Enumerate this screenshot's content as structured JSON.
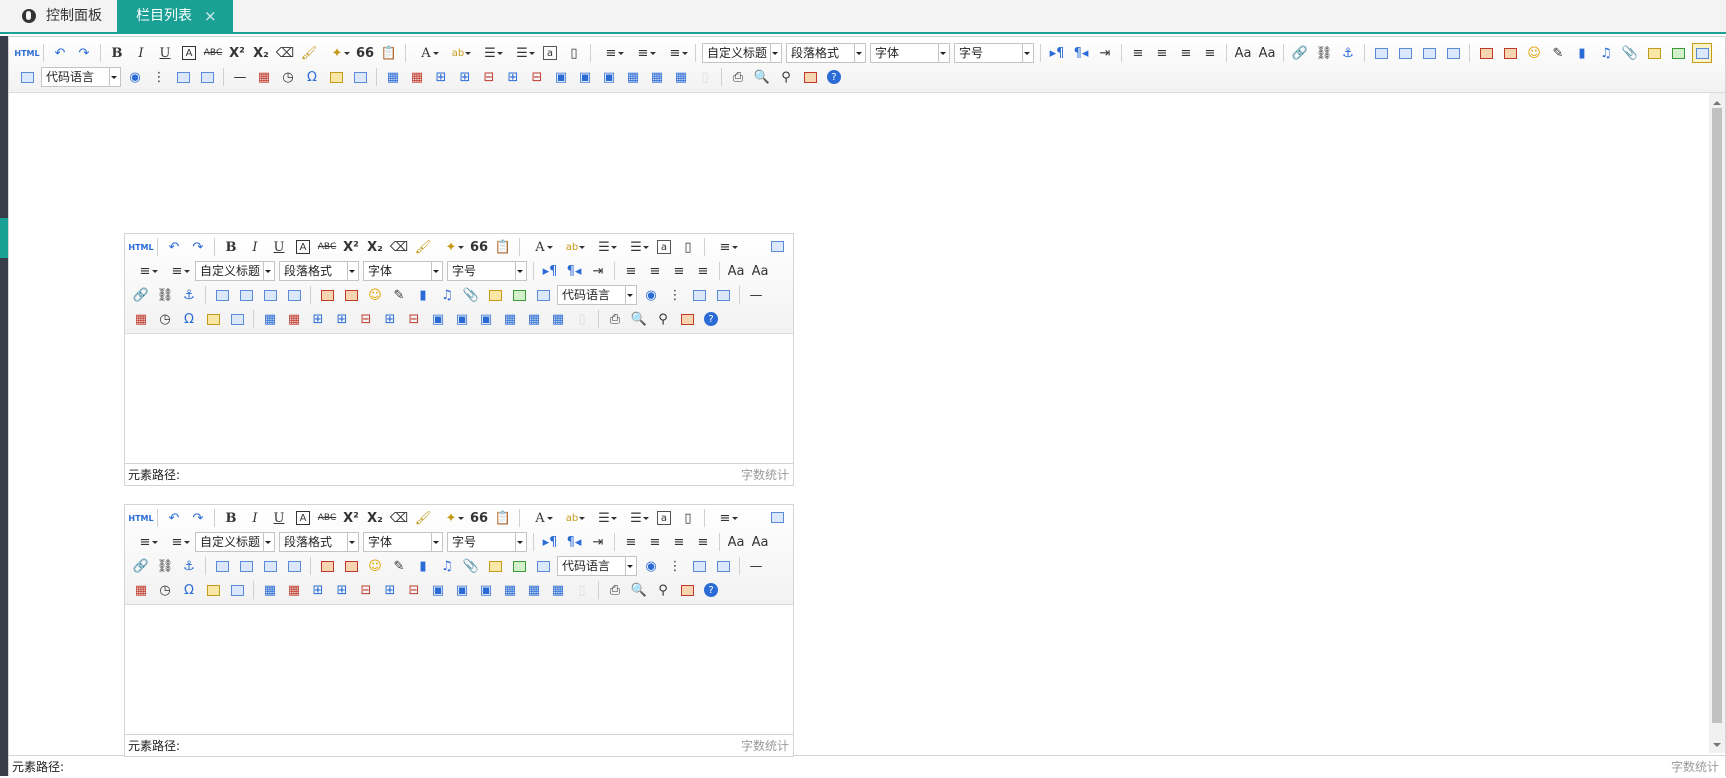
{
  "tabs": [
    {
      "label": "控制面板",
      "icon": "globe-icon",
      "active": false
    },
    {
      "label": "栏目列表",
      "active": true,
      "close": "×"
    }
  ],
  "toolbar": {
    "html_label": "HTML",
    "custom_heading": "自定义标题",
    "paragraph": "段落格式",
    "font_family": "字体",
    "font_size": "字号",
    "code_language": "代码语言",
    "bold": "B",
    "italic": "I",
    "underline": "U",
    "superscript": "X²",
    "subscript": "X₂",
    "quote": "66",
    "help": "?"
  },
  "main_editor": {
    "path_label": "元素路径:",
    "word_count": "字数统计"
  },
  "sub_editors": [
    {
      "path_label": "元素路径:",
      "word_count": "字数统计"
    },
    {
      "path_label": "元素路径:",
      "word_count": "字数统计"
    }
  ],
  "colors": {
    "accent": "#1aa094",
    "sidebar": "#393d49",
    "icon_blue": "#2a6bd6"
  }
}
